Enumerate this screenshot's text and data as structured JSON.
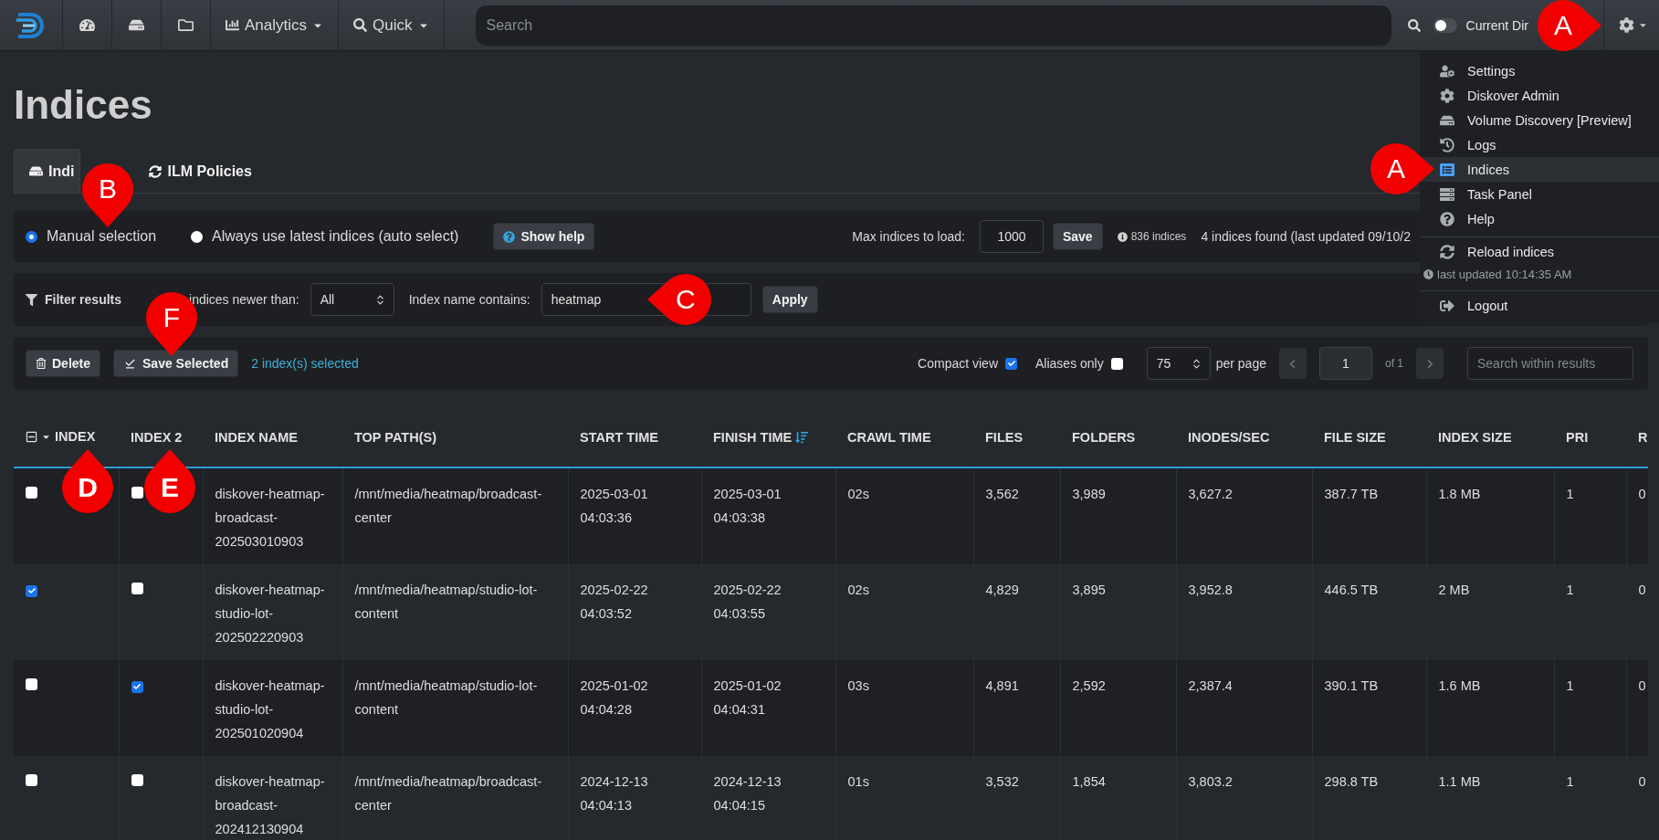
{
  "navbar": {
    "menus": [
      {
        "label": "Analytics"
      },
      {
        "label": "Quick"
      }
    ],
    "search": {
      "placeholder": "Search"
    },
    "current_dir": {
      "label": "Current Dir",
      "on": false
    },
    "settings_callout": {
      "letter": "A"
    }
  },
  "user_menu": {
    "sections": [
      {
        "items": [
          {
            "label": "Settings",
            "selected": false
          },
          {
            "label": "Diskover Admin",
            "selected": false
          },
          {
            "label": "Volume Discovery [Preview]",
            "selected": false
          },
          {
            "label": "Logs",
            "selected": false
          },
          {
            "label": "Indices",
            "selected": true,
            "callout": {
              "letter": "A"
            }
          },
          {
            "label": "Task Panel",
            "selected": false
          },
          {
            "label": "Help",
            "selected": false
          }
        ]
      },
      {
        "items": [
          {
            "label": "Reload indices",
            "selected": false
          }
        ],
        "note": "last updated 10:14:35 AM"
      },
      {
        "items": [
          {
            "label": "Logout",
            "selected": false
          }
        ]
      }
    ]
  },
  "page_title": "Indices",
  "tabs": [
    {
      "label": "Indi",
      "selected": true
    },
    {
      "label": "ILM Policies",
      "selected": false
    }
  ],
  "selection": {
    "options": [
      {
        "label": "Manual selection",
        "selected": true,
        "callout": {
          "letter": "B"
        }
      },
      {
        "label": "Always use latest indices (auto select)",
        "selected": false
      }
    ],
    "help_button": "Show help",
    "max_label": "Max indices to load:",
    "max_value": "1000",
    "save_button": "Save",
    "total": "836 indices",
    "found": "4 indices found (last updated 09/10/2"
  },
  "filter": {
    "title": "Filter results",
    "newer_label": "indices newer than:",
    "newer_value": "All",
    "name_label": "Index name contains:",
    "name_value": "heatmap",
    "name_callout": {
      "letter": "C"
    },
    "apply_button": "Apply"
  },
  "actions": {
    "delete_button": "Delete",
    "save_selected_button": "Save Selected",
    "save_callout": {
      "letter": "F"
    },
    "selected_count": "2 index(s) selected",
    "compact_view": {
      "label": "Compact view",
      "checked": true
    },
    "aliases_only": {
      "label": "Aliases only",
      "checked": false
    },
    "per_page_value": "75",
    "per_page_label": "per page",
    "page_value": "1",
    "page_of": "of 1",
    "results_search": {
      "placeholder": "Search within results"
    }
  },
  "table": {
    "columns": [
      {
        "label": "INDEX",
        "sorted": false,
        "callout": {
          "letter": "D"
        }
      },
      {
        "label": "INDEX 2",
        "sorted": false,
        "callout": {
          "letter": "E"
        }
      },
      {
        "label": "INDEX NAME",
        "sorted": false
      },
      {
        "label": "TOP PATH(S)",
        "sorted": false
      },
      {
        "label": "START TIME",
        "sorted": false
      },
      {
        "label": "FINISH TIME",
        "sorted": true
      },
      {
        "label": "CRAWL TIME",
        "sorted": false
      },
      {
        "label": "FILES",
        "sorted": false
      },
      {
        "label": "FOLDERS",
        "sorted": false
      },
      {
        "label": "INODES/SEC",
        "sorted": false
      },
      {
        "label": "FILE SIZE",
        "sorted": false
      },
      {
        "label": "INDEX SIZE",
        "sorted": false
      },
      {
        "label": "PRI",
        "sorted": false
      },
      {
        "label": "R",
        "sorted": false
      }
    ],
    "rows": [
      {
        "cells": [
          {
            "kind": "checkbox",
            "checked": false
          },
          {
            "kind": "checkbox",
            "checked": false
          },
          "diskover-heatmap-broadcast-202503010903",
          "/mnt/media/heatmap/broadcast-center",
          "2025-03-01 04:03:36",
          "2025-03-01 04:03:38",
          "02s",
          "3,562",
          "3,989",
          "3,627.2",
          "387.7 TB",
          "1.8 MB",
          "1",
          "0"
        ]
      },
      {
        "cells": [
          {
            "kind": "checkbox",
            "checked": true
          },
          {
            "kind": "checkbox",
            "checked": false
          },
          "diskover-heatmap-studio-lot-202502220903",
          "/mnt/media/heatmap/studio-lot-content",
          "2025-02-22 04:03:52",
          "2025-02-22 04:03:55",
          "02s",
          "4,829",
          "3,895",
          "3,952.8",
          "446.5 TB",
          "2 MB",
          "1",
          "0"
        ]
      },
      {
        "cells": [
          {
            "kind": "checkbox",
            "checked": false
          },
          {
            "kind": "checkbox",
            "checked": true
          },
          "diskover-heatmap-studio-lot-202501020904",
          "/mnt/media/heatmap/studio-lot-content",
          "2025-01-02 04:04:28",
          "2025-01-02 04:04:31",
          "03s",
          "4,891",
          "2,592",
          "2,387.4",
          "390.1 TB",
          "1.6 MB",
          "1",
          "0"
        ]
      },
      {
        "cells": [
          {
            "kind": "checkbox",
            "checked": false
          },
          {
            "kind": "checkbox",
            "checked": false
          },
          "diskover-heatmap-broadcast-202412130904",
          "/mnt/media/heatmap/broadcast-center",
          "2024-12-13 04:04:13",
          "2024-12-13 04:04:15",
          "01s",
          "3,532",
          "1,854",
          "3,803.2",
          "298.8 TB",
          "1.1 MB",
          "1",
          "0"
        ]
      }
    ]
  }
}
